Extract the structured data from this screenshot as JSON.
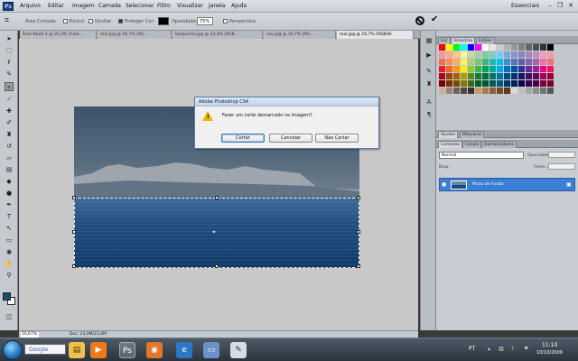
{
  "menubar": {
    "logo": "Ps",
    "items": [
      "Arquivo",
      "Editar",
      "Imagem",
      "Camada",
      "Selecionar",
      "Filtro",
      "Visualizar",
      "Janela",
      "Ajuda"
    ],
    "workspace": "Essenciais"
  },
  "options": {
    "area_cortada": "Área Cortada:",
    "excluir": "Excluir",
    "ocultar": "Ocultar",
    "proteger": "Proteger",
    "cor": "Cor:",
    "opacidade": "Opacidade:",
    "opacity_value": "75%",
    "perspectiva": "Perspectiva"
  },
  "tabs": [
    "Sem título-1 @ 33,3% (Cam...",
    "mar.jpg @ 16,7% (RG...",
    "barquinho.jpg @ 33,3% (RGB...",
    "ceu.jpg @ 16,7% (RG...",
    "mar.jpg @ 16,7% (RGB/8)"
  ],
  "active_tab_index": 4,
  "status": {
    "zoom": "16,67%",
    "doc": "Doc: 23,0M/23,0M"
  },
  "dialog": {
    "title": "Adobe Photoshop CS4",
    "message": "Fazer um corte demarcado na imagem?",
    "btn_cortar": "Cortar",
    "btn_cancelar": "Cancelar",
    "btn_nao_cortar": "Não Cortar"
  },
  "panels": {
    "top_tabs": [
      "Cor",
      "Amostras",
      "Estilos"
    ],
    "mid_tabs": [
      "Ajustes",
      "Máscaras"
    ],
    "layer_tabs": [
      "Camadas",
      "Canais",
      "Demarcadores"
    ],
    "blend_mode": "Normal",
    "opacity_label": "Opacidade:",
    "lock_label": "Bloq.:",
    "fill_label": "Preen.:",
    "layer_name": "Plano de Fundo"
  },
  "swatches": [
    "#ff0000",
    "#ffff00",
    "#00ff00",
    "#00ffff",
    "#0000ff",
    "#ff00ff",
    "#ffffff",
    "#e6e6e6",
    "#cccccc",
    "#b3b3b3",
    "#999999",
    "#808080",
    "#666666",
    "#4d4d4d",
    "#333333",
    "#000000",
    "#f5989d",
    "#f9ad81",
    "#fdc68a",
    "#fff79a",
    "#c4df9b",
    "#a2d39c",
    "#82ca9d",
    "#7bcdc8",
    "#6ecff6",
    "#7ea7d8",
    "#8493ca",
    "#8882be",
    "#a187be",
    "#bc8dbf",
    "#f49ac2",
    "#f6989d",
    "#f26c4f",
    "#f68e55",
    "#fbaf5c",
    "#fff467",
    "#acd372",
    "#7cc576",
    "#3bb878",
    "#1abbb4",
    "#00bff3",
    "#438ccb",
    "#5574b9",
    "#605ca8",
    "#855fa8",
    "#a763a8",
    "#f06eaa",
    "#f26d7d",
    "#ed1c24",
    "#f26522",
    "#f7941d",
    "#fff200",
    "#8dc73f",
    "#39b54a",
    "#00a651",
    "#00a99d",
    "#00aeef",
    "#0072bc",
    "#0054a6",
    "#2e3192",
    "#662d91",
    "#92278f",
    "#ec008c",
    "#ed145b",
    "#9e0b0f",
    "#a0410d",
    "#a36209",
    "#aba000",
    "#598527",
    "#1a7b30",
    "#007236",
    "#00746b",
    "#0076a3",
    "#004b80",
    "#003471",
    "#1b1464",
    "#440e62",
    "#630460",
    "#9e005d",
    "#9e0039",
    "#790000",
    "#7b2e00",
    "#7d4900",
    "#827b00",
    "#406618",
    "#005e20",
    "#005826",
    "#005952",
    "#005b7f",
    "#003663",
    "#002157",
    "#0d004c",
    "#32004b",
    "#4b0049",
    "#7b0046",
    "#7a0026",
    "#c7b299",
    "#998675",
    "#736357",
    "#534741",
    "#37302d",
    "#c69c6d",
    "#a67c52",
    "#8c6239",
    "#754c24",
    "#603913",
    "#d8d8d8",
    "#bfbfbf",
    "#a6a6a6",
    "#8c8c8c",
    "#737373",
    "#595959"
  ],
  "taskbar": {
    "google": "Google",
    "lang": "PT",
    "time": "11:10",
    "date": "10/10/2009"
  }
}
